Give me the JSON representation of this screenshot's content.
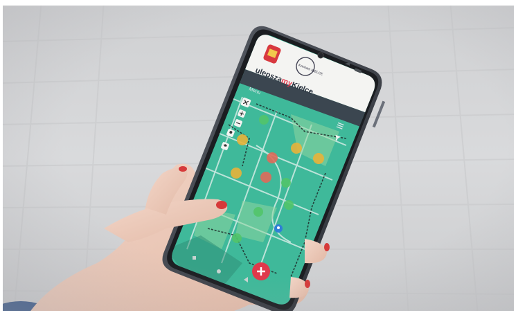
{
  "app": {
    "logo_parts": [
      "ulepsza",
      "my",
      "Kielce"
    ],
    "menu_label": "Menu",
    "badge_text": "Kocham KIELCE"
  },
  "map": {
    "markers": [
      {
        "status": "green"
      },
      {
        "status": "yellow"
      },
      {
        "status": "yellow"
      },
      {
        "status": "yellow"
      },
      {
        "status": "red"
      },
      {
        "status": "yellow"
      },
      {
        "status": "red"
      },
      {
        "status": "green"
      },
      {
        "status": "green"
      },
      {
        "status": "green"
      },
      {
        "status": "green"
      },
      {
        "status": "blue"
      }
    ],
    "controls": [
      "close-icon",
      "zoom-in-icon",
      "zoom-out-icon",
      "location-icon",
      "layers-icon",
      "filter-icon"
    ]
  },
  "colors": {
    "accent_red": "#e0394b",
    "map_green": "#3fb99a",
    "marker_green": "#52c46a",
    "marker_yellow": "#e8b23a",
    "marker_red": "#e06a5a",
    "marker_blue": "#2f7fd6",
    "header_dark": "#3b4650"
  }
}
